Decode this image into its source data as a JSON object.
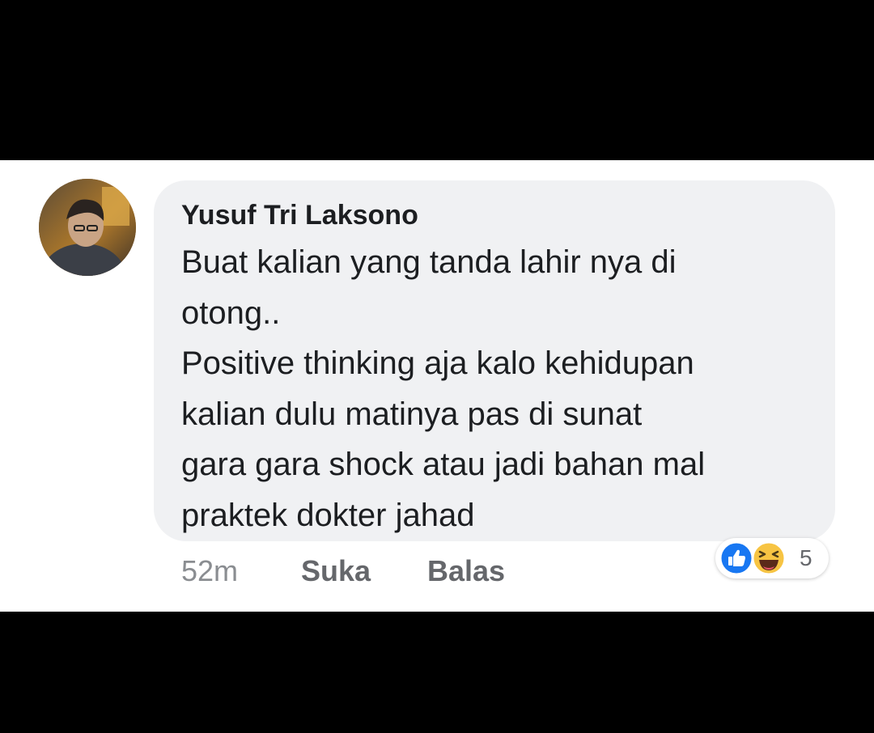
{
  "comment": {
    "author": "Yusuf Tri Laksono",
    "lines": [
      "Buat kalian yang tanda lahir nya di",
      "otong..",
      "Positive thinking aja kalo kehidupan",
      "kalian dulu matinya pas di sunat",
      "gara gara shock atau jadi bahan mal",
      "praktek dokter jahad"
    ],
    "time": "52m",
    "like_label": "Suka",
    "reply_label": "Balas",
    "reactions": {
      "icons": [
        "like-icon",
        "haha-icon"
      ],
      "count": "5"
    }
  },
  "colors": {
    "bubble": "#f0f1f3",
    "text": "#1c1e21",
    "muted": "#65676b",
    "like_blue": "#1877f2",
    "haha_yellow": "#f7c443"
  }
}
